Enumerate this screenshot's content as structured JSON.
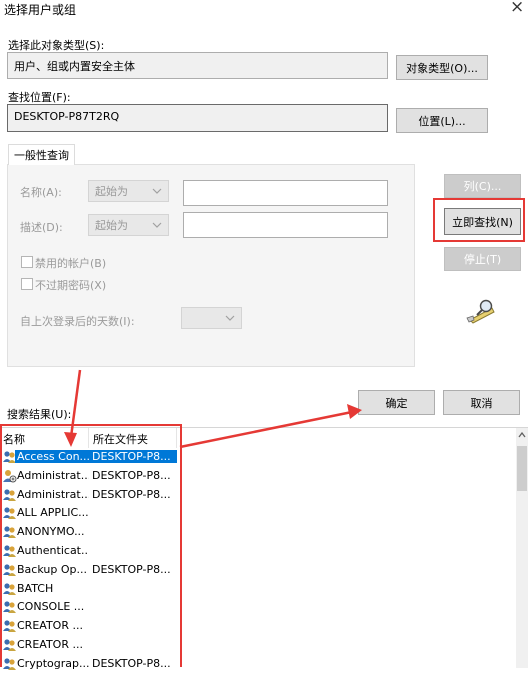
{
  "window": {
    "title": "选择用户或组",
    "close_glyph": "×"
  },
  "object_type": {
    "label": "选择此对象类型(S):",
    "value": "用户、组或内置安全主体",
    "button": "对象类型(O)..."
  },
  "location": {
    "label": "查找位置(F):",
    "value": "DESKTOP-P87T2RQ",
    "button": "位置(L)..."
  },
  "query": {
    "tab": "一般性查询",
    "name_label": "名称(A):",
    "name_mode": "起始为",
    "desc_label": "描述(D):",
    "desc_mode": "起始为",
    "disabled_accounts": "禁用的帐户(B)",
    "no_expire_password": "不过期密码(X)",
    "days_since_login": "自上次登录后的天数(I):"
  },
  "actions": {
    "columns": "列(C)...",
    "search_now": "立即查找(N)",
    "stop": "停止(T)",
    "ok": "确定",
    "cancel": "取消"
  },
  "results": {
    "label": "搜索结果(U):",
    "columns": [
      "名称",
      "所在文件夹"
    ],
    "rows": [
      {
        "name": "Access Con...",
        "folder": "DESKTOP-P8...",
        "selected": true,
        "icon": "group-icon"
      },
      {
        "name": "Administrat...",
        "folder": "DESKTOP-P8...",
        "icon": "user-icon"
      },
      {
        "name": "Administrat...",
        "folder": "DESKTOP-P8...",
        "icon": "group-icon"
      },
      {
        "name": "ALL APPLIC...",
        "folder": "",
        "icon": "group-icon"
      },
      {
        "name": "ANONYMO...",
        "folder": "",
        "icon": "group-icon"
      },
      {
        "name": "Authenticat...",
        "folder": "",
        "icon": "group-icon"
      },
      {
        "name": "Backup Op...",
        "folder": "DESKTOP-P8...",
        "icon": "group-icon"
      },
      {
        "name": "BATCH",
        "folder": "",
        "icon": "group-icon"
      },
      {
        "name": "CONSOLE ...",
        "folder": "",
        "icon": "group-icon"
      },
      {
        "name": "CREATOR ...",
        "folder": "",
        "icon": "group-icon"
      },
      {
        "name": "CREATOR ...",
        "folder": "",
        "icon": "group-icon"
      },
      {
        "name": "Cryptograp...",
        "folder": "DESKTOP-P8...",
        "icon": "group-icon"
      }
    ]
  },
  "colors": {
    "highlight": "#0078d7",
    "annotation_red": "#e53935"
  }
}
